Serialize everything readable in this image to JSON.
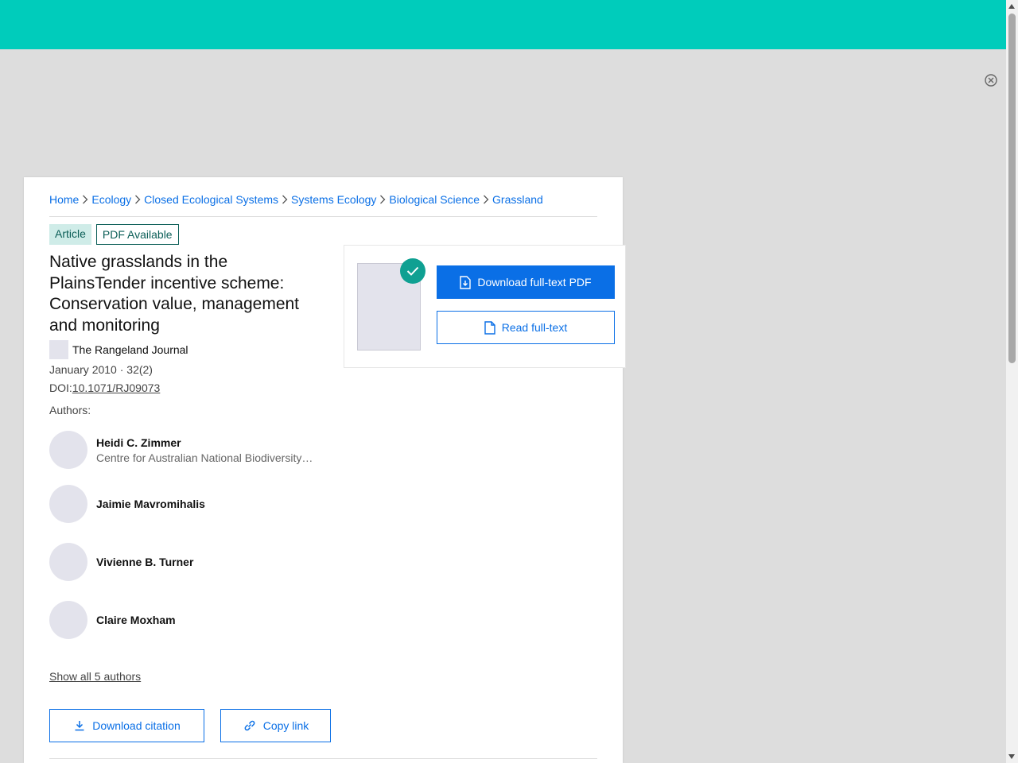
{
  "breadcrumb": [
    "Home",
    "Ecology",
    "Closed Ecological Systems",
    "Systems Ecology",
    "Biological Science",
    "Grassland"
  ],
  "badges": {
    "type": "Article",
    "availability": "PDF Available"
  },
  "article": {
    "title": "Native grasslands in the PlainsTender incentive scheme: Conservation value, management and monitoring",
    "journal": "The Rangeland Journal",
    "date_issue": "January 2010 · 32(2)",
    "doi_label": "DOI:",
    "doi": "10.1071/RJ09073"
  },
  "authors_label": "Authors:",
  "authors": [
    {
      "name": "Heidi C. Zimmer",
      "affiliation": "Centre for Australian National Biodiversity Research"
    },
    {
      "name": "Jaimie Mavromihalis"
    },
    {
      "name": "Vivienne B. Turner"
    },
    {
      "name": "Claire Moxham"
    }
  ],
  "show_all_authors": "Show all 5 authors",
  "actions": {
    "download_citation": "Download citation",
    "copy_link": "Copy link"
  },
  "pdf_panel": {
    "download_pdf": "Download full-text PDF",
    "read_fulltext": "Read full-text"
  },
  "colors": {
    "header": "#00ccbb",
    "accent": "#0a6fe6",
    "check": "#0fa092",
    "badge_bg": "#cfece8",
    "badge_text": "#0b5e57"
  },
  "icons": [
    "close-icon",
    "chevron-right-icon",
    "check-icon",
    "file-download-icon",
    "file-icon",
    "download-icon",
    "link-icon"
  ]
}
